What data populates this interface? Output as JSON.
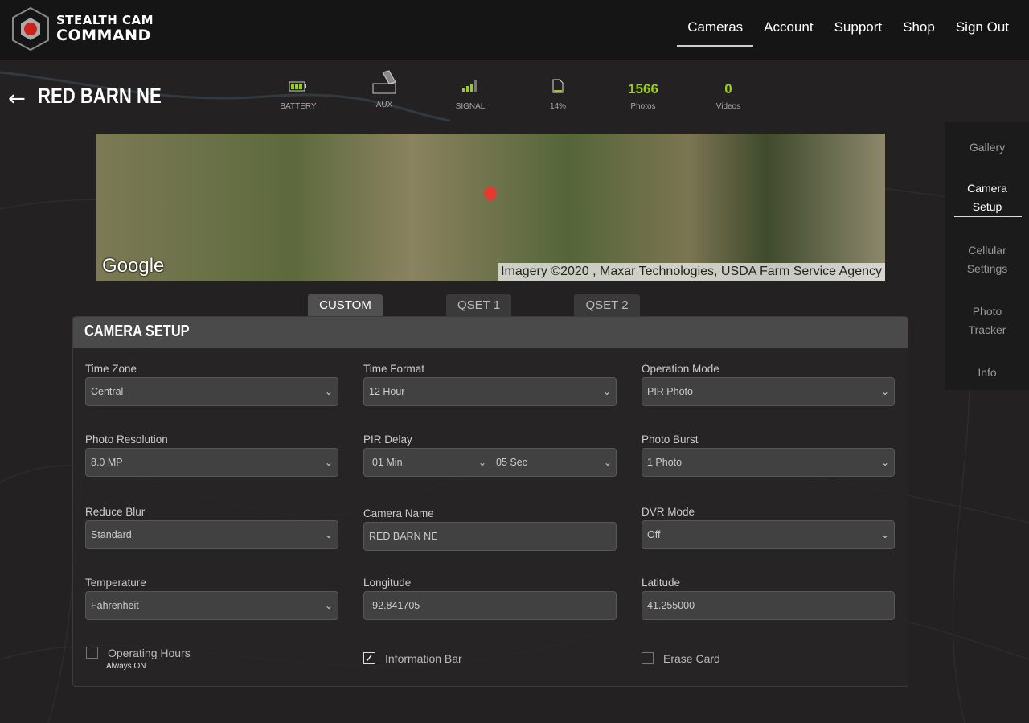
{
  "brand": {
    "line1": "STEALTH CAM",
    "line2": "COMMAND"
  },
  "nav": [
    "Cameras",
    "Account",
    "Support",
    "Shop",
    "Sign Out"
  ],
  "camera": {
    "title": "RED BARN NE"
  },
  "status": {
    "battery": "BATTERY",
    "aux": "AUX",
    "signal": "SIGNAL",
    "storage": "14%",
    "photos_count": "1566",
    "photos_label": "Photos",
    "videos_count": "0",
    "videos_label": "Videos"
  },
  "map": {
    "logo": "Google",
    "attribution": "Imagery ©2020 , Maxar Technologies, USDA Farm Service Agency"
  },
  "tabs": [
    "CUSTOM",
    "QSET 1",
    "QSET 2"
  ],
  "panel": {
    "title": "CAMERA SETUP",
    "fields": [
      {
        "label": "Time Zone",
        "value": "Central",
        "type": "select"
      },
      {
        "label": "Time Format",
        "value": "12 Hour",
        "type": "select"
      },
      {
        "label": "Operation Mode",
        "value": "PIR Photo",
        "type": "select"
      },
      {
        "label": "Photo Resolution",
        "value": "8.0 MP",
        "type": "select"
      },
      {
        "label": "PIR Delay",
        "value": "01 Min",
        "value2": "05 Sec",
        "type": "dual"
      },
      {
        "label": "Photo Burst",
        "value": "1 Photo",
        "type": "select"
      },
      {
        "label": "Reduce Blur",
        "value": "Standard",
        "type": "select"
      },
      {
        "label": "Camera Name",
        "value": "RED BARN NE",
        "type": "input"
      },
      {
        "label": "DVR Mode",
        "value": "Off",
        "type": "select"
      },
      {
        "label": "Temperature",
        "value": "Fahrenheit",
        "type": "select"
      },
      {
        "label": "Longitude",
        "value": "-92.841705",
        "type": "input"
      },
      {
        "label": "Latitude",
        "value": "41.255000",
        "type": "input"
      }
    ],
    "checkboxes": [
      {
        "label": "Operating Hours",
        "checked": false,
        "sub": "Always ON"
      },
      {
        "label": "Information Bar",
        "checked": true
      },
      {
        "label": "Erase Card",
        "checked": false
      }
    ]
  },
  "sidebar": [
    "Gallery",
    "Camera Setup",
    "Cellular Settings",
    "Photo Tracker",
    "Info"
  ],
  "colors": {
    "accent": "#9acd1e",
    "header": "#161516",
    "background": "#232122"
  }
}
